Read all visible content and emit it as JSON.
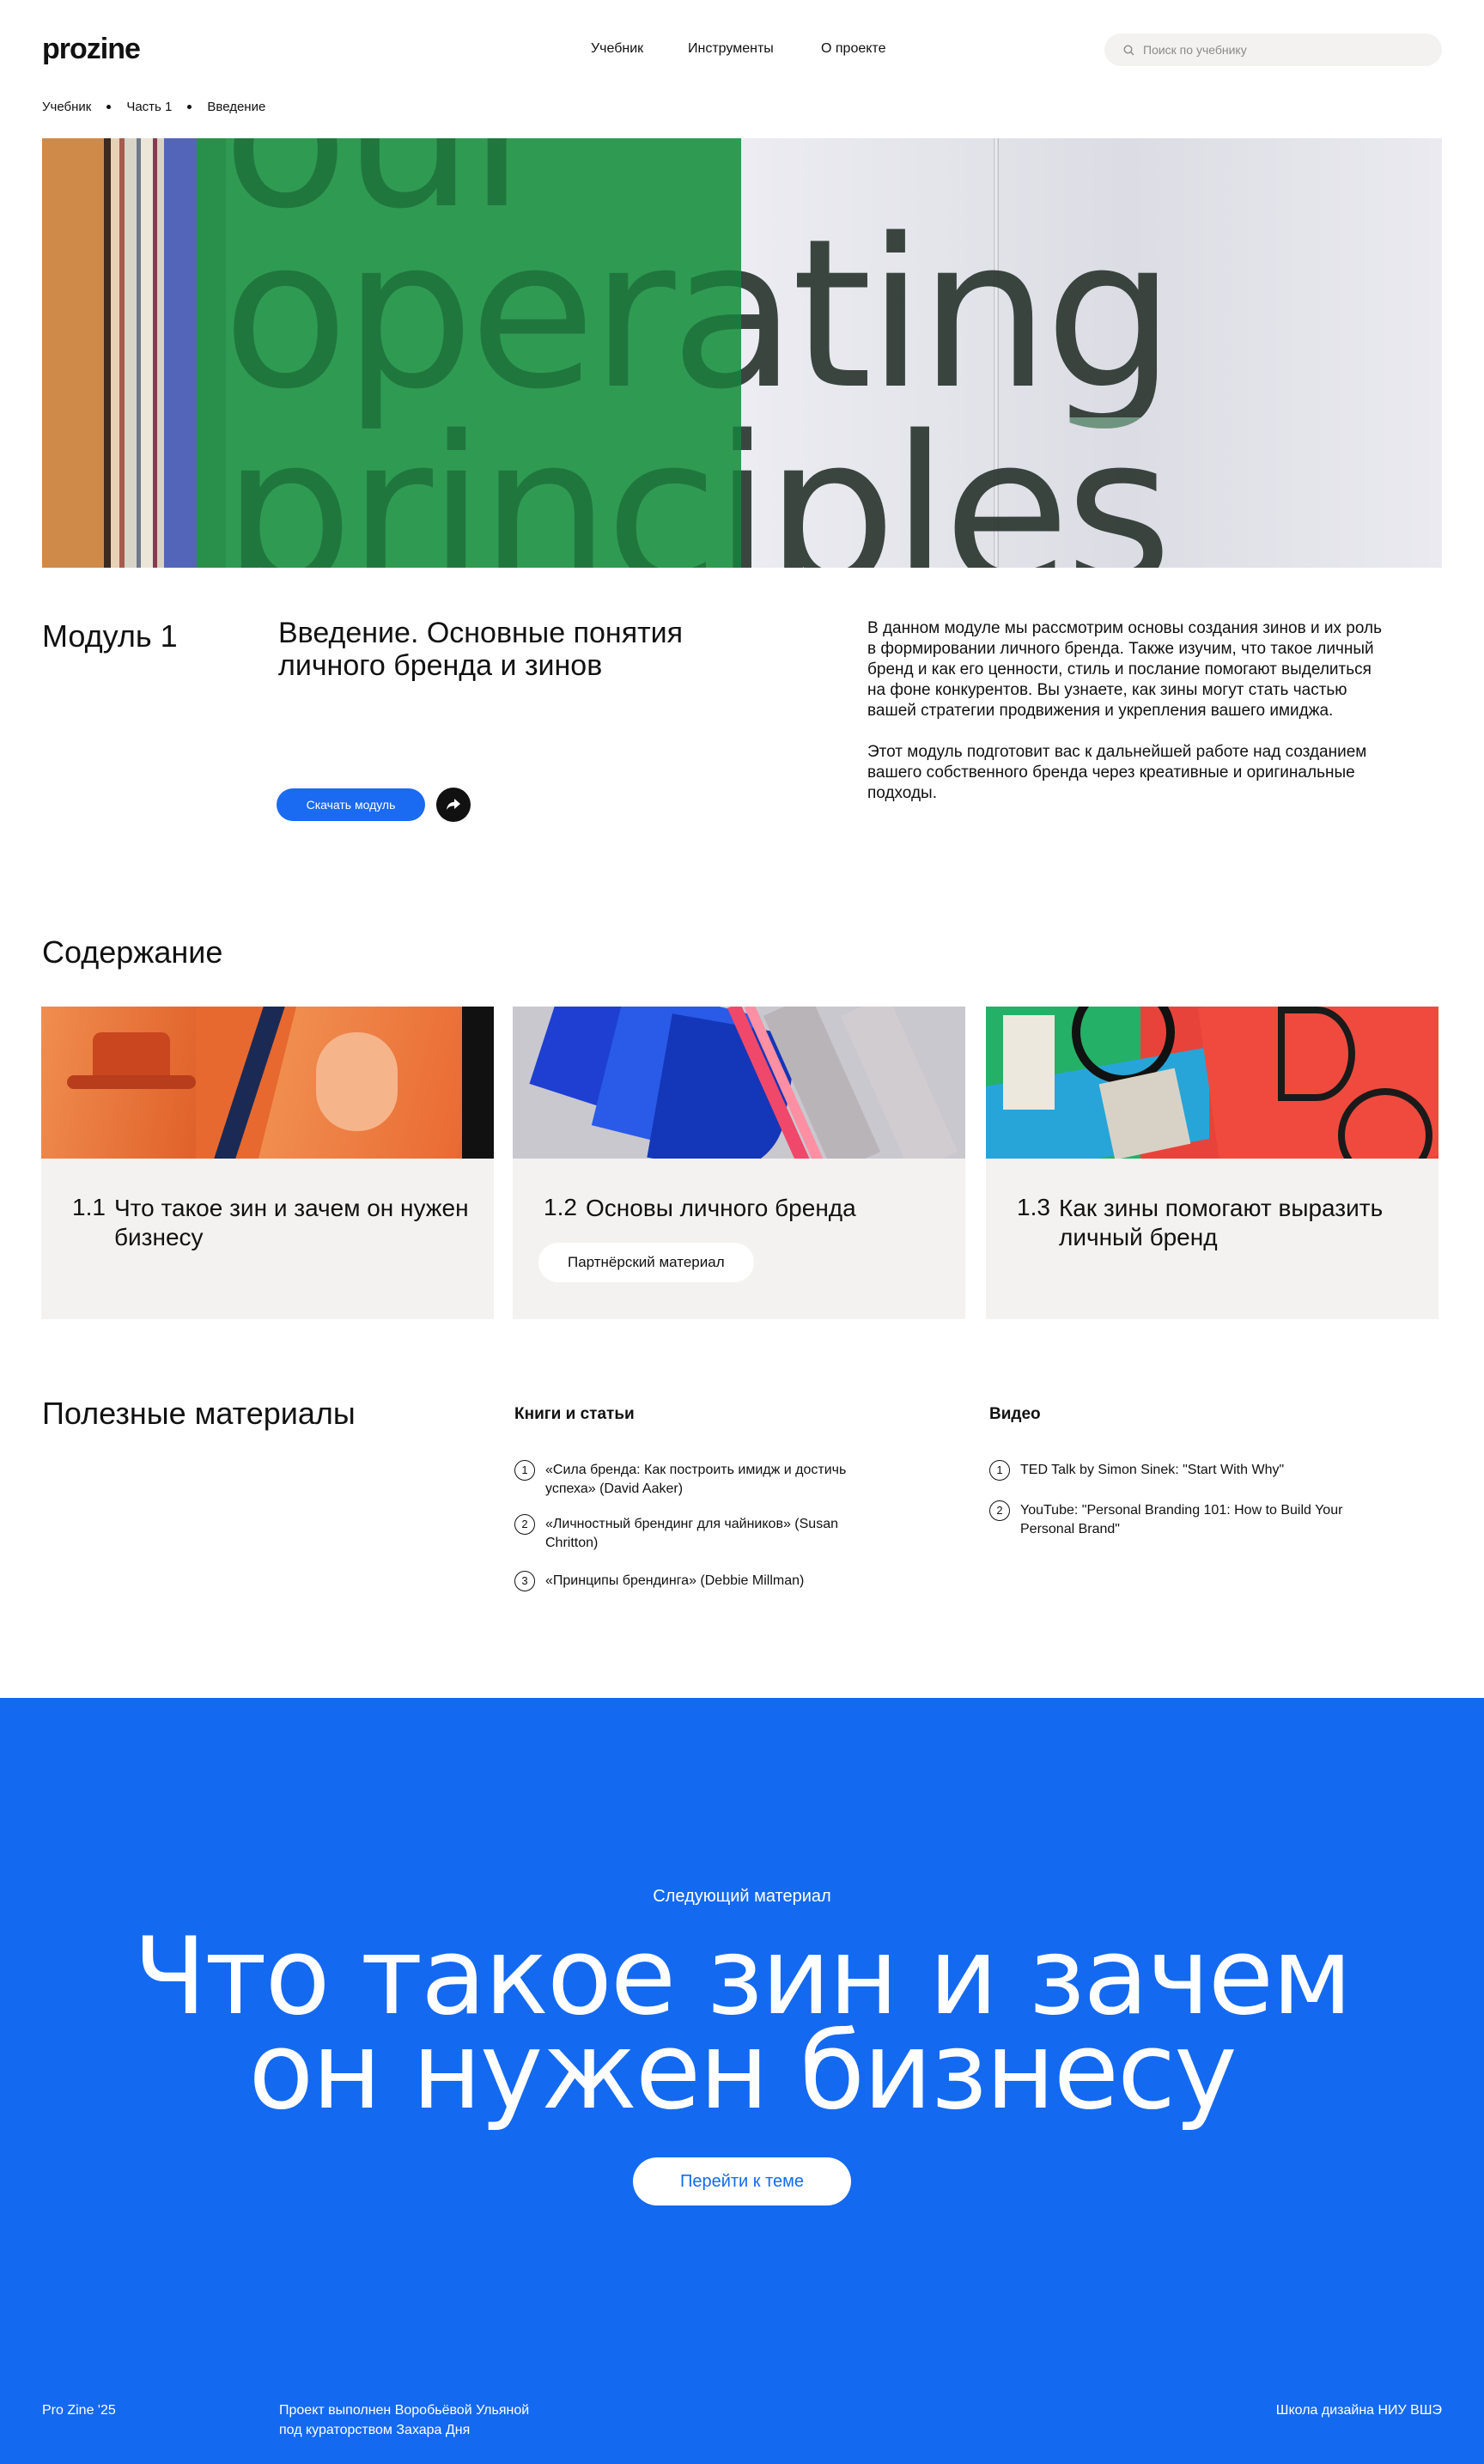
{
  "header": {
    "logo": "prozine",
    "nav": [
      "Учебник",
      "Инструменты",
      "О проекте"
    ],
    "search_placeholder": "Поиск по учебнику",
    "search_icon": "search-icon"
  },
  "breadcrumb": [
    "Учебник",
    "Часть 1",
    "Введение"
  ],
  "hero": {
    "line1": "our",
    "line2": "operating",
    "line3": "principles"
  },
  "module": {
    "label": "Модуль 1",
    "title": "Введение. Основные понятия личного бренда и зинов",
    "download_label": "Скачать модуль",
    "share_icon": "share-icon",
    "desc_1": "В данном модуле мы рассмотрим основы создания зинов и их роль в формировании личного бренда. Также изучим, что такое личный бренд и как его ценности, стиль и послание помогают выделиться на фоне конкурентов. Вы узнаете, как зины могут стать частью вашей стратегии продвижения и укрепления вашего имиджа.",
    "desc_2": "Этот модуль подготовит вас к дальнейшей работе над созданием вашего собственного бренда через креативные и оригинальные подходы."
  },
  "contents": {
    "title": "Содержание",
    "cards": [
      {
        "num": "1.1",
        "title": "Что такое зин и зачем он нужен бизнесу"
      },
      {
        "num": "1.2",
        "title": "Основы личного бренда",
        "badge": "Партнёрский материал"
      },
      {
        "num": "1.3",
        "title": "Как зины помогают выразить личный бренд"
      }
    ]
  },
  "materials": {
    "title": "Полезные материалы",
    "books_title": "Книги и статьи",
    "books": [
      {
        "n": "1",
        "text": "«Сила бренда: Как построить имидж и достичь успеха» (David Aaker)"
      },
      {
        "n": "2",
        "text": "«Личностный брендинг для чайников» (Susan Chritton)"
      },
      {
        "n": "3",
        "text": "«Принципы брендинга» (Debbie Millman)"
      }
    ],
    "video_title": "Видео",
    "videos": [
      {
        "n": "1",
        "text": "TED Talk by Simon Sinek: \"Start With Why\""
      },
      {
        "n": "2",
        "text": "YouTube: \"Personal Branding 101: How to Build Your Personal Brand\""
      }
    ]
  },
  "next": {
    "label": "Следующий материал",
    "title_line1": "Что такое зин и зачем",
    "title_line2": "он нужен бизнесу",
    "button": "Перейти к теме"
  },
  "footer": {
    "left": "Pro Zine '25",
    "middle_1": "Проект выполнен Воробьёвой Ульяной",
    "middle_2": "под кураторством Захара Дня",
    "right": "Школа дизайна НИУ ВШЭ"
  },
  "colors": {
    "accent": "#1469f1",
    "card_bg": "#f3f2f1"
  }
}
